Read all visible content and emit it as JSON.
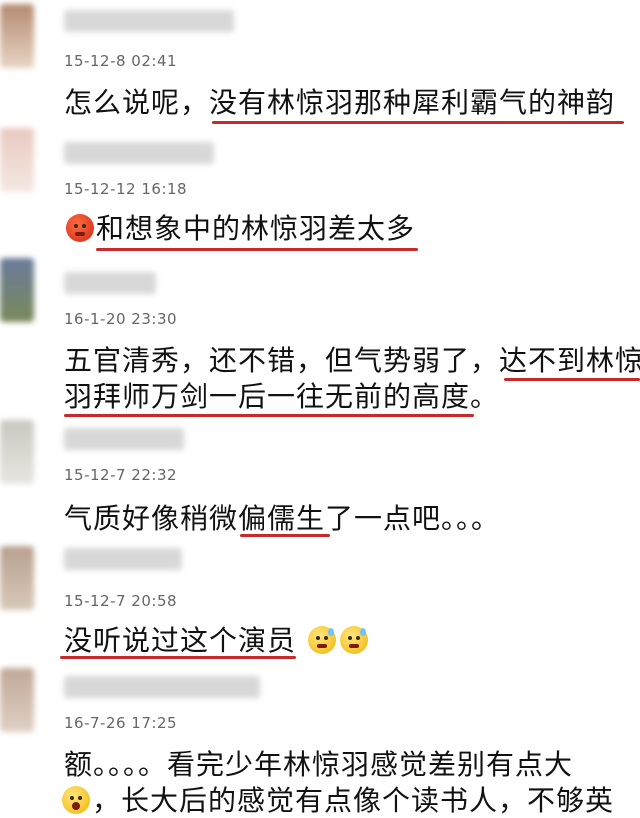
{
  "comments": [
    {
      "timestamp": "15-12-8 02:41",
      "lines": [
        "怎么说呢，没有林惊羽那种犀利霸气的神韵"
      ]
    },
    {
      "timestamp": "15-12-12 16:18",
      "lines": [
        "和想象中的林惊羽差太多"
      ]
    },
    {
      "timestamp": "16-1-20 23:30",
      "lines": [
        "五官清秀，还不错，但气势弱了，达不到林惊",
        "羽拜师万剑一后一往无前的高度。"
      ]
    },
    {
      "timestamp": "15-12-7 22:32",
      "lines": [
        "气质好像稍微偏儒生了一点吧。。。"
      ]
    },
    {
      "timestamp": "15-12-7 20:58",
      "lines": [
        "没听说过这个演员"
      ]
    },
    {
      "timestamp": "16-7-26 17:25",
      "lines": [
        "额。。。。看完少年林惊羽感觉差别有点大",
        "，长大后的感觉有点像个读书人，不够英"
      ]
    }
  ],
  "icons": {
    "comment2_emoji": "angry-face-icon",
    "comment5_emoji": "sweat-smile-icon",
    "comment6_emoji": "shocked-face-icon"
  },
  "colors": {
    "underline": "#c62a2a",
    "timestamp": "#666666"
  }
}
